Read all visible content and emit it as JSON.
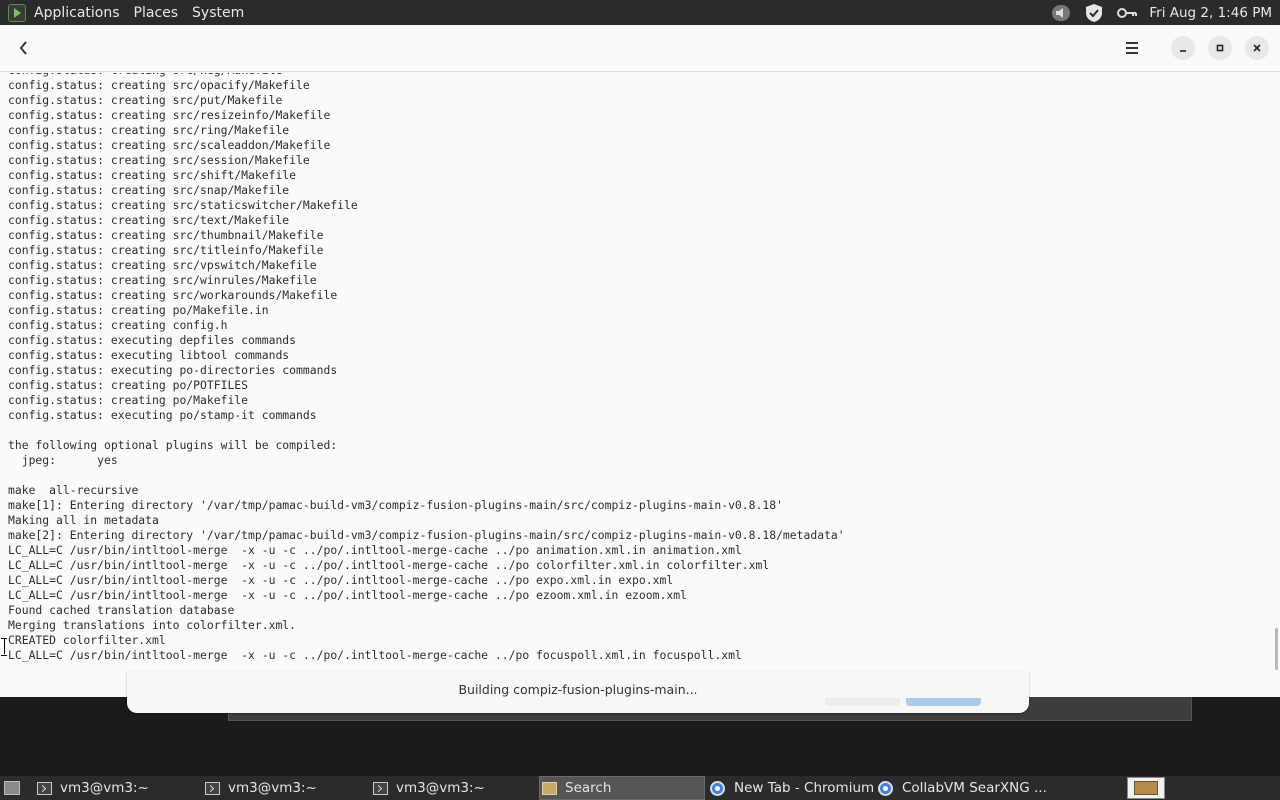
{
  "top_panel": {
    "menus": [
      "Applications",
      "Places",
      "System"
    ],
    "clock": "Fri Aug  2,  1:46 PM",
    "tray_icons": [
      "volume-icon",
      "shield-icon",
      "key-icon"
    ]
  },
  "window": {
    "back_icon": "back-arrow-icon",
    "menu_icon": "hamburger-menu-icon",
    "controls": [
      "minimize-icon",
      "maximize-icon",
      "close-icon"
    ],
    "terminal_lines": [
      "config.status: creating src/neg/Makefile",
      "config.status: creating src/opacify/Makefile",
      "config.status: creating src/put/Makefile",
      "config.status: creating src/resizeinfo/Makefile",
      "config.status: creating src/ring/Makefile",
      "config.status: creating src/scaleaddon/Makefile",
      "config.status: creating src/session/Makefile",
      "config.status: creating src/shift/Makefile",
      "config.status: creating src/snap/Makefile",
      "config.status: creating src/staticswitcher/Makefile",
      "config.status: creating src/text/Makefile",
      "config.status: creating src/thumbnail/Makefile",
      "config.status: creating src/titleinfo/Makefile",
      "config.status: creating src/vpswitch/Makefile",
      "config.status: creating src/winrules/Makefile",
      "config.status: creating src/workarounds/Makefile",
      "config.status: creating po/Makefile.in",
      "config.status: creating config.h",
      "config.status: executing depfiles commands",
      "config.status: executing libtool commands",
      "config.status: executing po-directories commands",
      "config.status: creating po/POTFILES",
      "config.status: creating po/Makefile",
      "config.status: executing po/stamp-it commands",
      "",
      "the following optional plugins will be compiled:",
      "  jpeg:      yes",
      "",
      "make  all-recursive",
      "make[1]: Entering directory '/var/tmp/pamac-build-vm3/compiz-fusion-plugins-main/src/compiz-plugins-main-v0.8.18'",
      "Making all in metadata",
      "make[2]: Entering directory '/var/tmp/pamac-build-vm3/compiz-fusion-plugins-main/src/compiz-plugins-main-v0.8.18/metadata'",
      "LC_ALL=C /usr/bin/intltool-merge  -x -u -c ../po/.intltool-merge-cache ../po animation.xml.in animation.xml",
      "LC_ALL=C /usr/bin/intltool-merge  -x -u -c ../po/.intltool-merge-cache ../po colorfilter.xml.in colorfilter.xml",
      "LC_ALL=C /usr/bin/intltool-merge  -x -u -c ../po/.intltool-merge-cache ../po expo.xml.in expo.xml",
      "LC_ALL=C /usr/bin/intltool-merge  -x -u -c ../po/.intltool-merge-cache ../po ezoom.xml.in ezoom.xml",
      "Found cached translation database",
      "Merging translations into colorfilter.xml.",
      "CREATED colorfilter.xml",
      "LC_ALL=C /usr/bin/intltool-merge  -x -u -c ../po/.intltool-merge-cache ../po focuspoll.xml.in focuspoll.xml"
    ],
    "status": "Building compiz-fusion-plugins-main..."
  },
  "taskbar": {
    "tasks": [
      {
        "label": "vm3@vm3:~",
        "icon": "terminal-icon"
      },
      {
        "label": "vm3@vm3:~",
        "icon": "terminal-icon"
      },
      {
        "label": "vm3@vm3:~",
        "icon": "terminal-icon"
      },
      {
        "label": "Search",
        "icon": "package-search-icon"
      },
      {
        "label": "New Tab - Chromium",
        "icon": "chromium-icon"
      },
      {
        "label": "CollabVM SearXNG ...",
        "icon": "chromium-icon"
      }
    ],
    "show_desktop_icon": "show-desktop-icon",
    "workspace_icon": "workspace-switcher-icon"
  }
}
